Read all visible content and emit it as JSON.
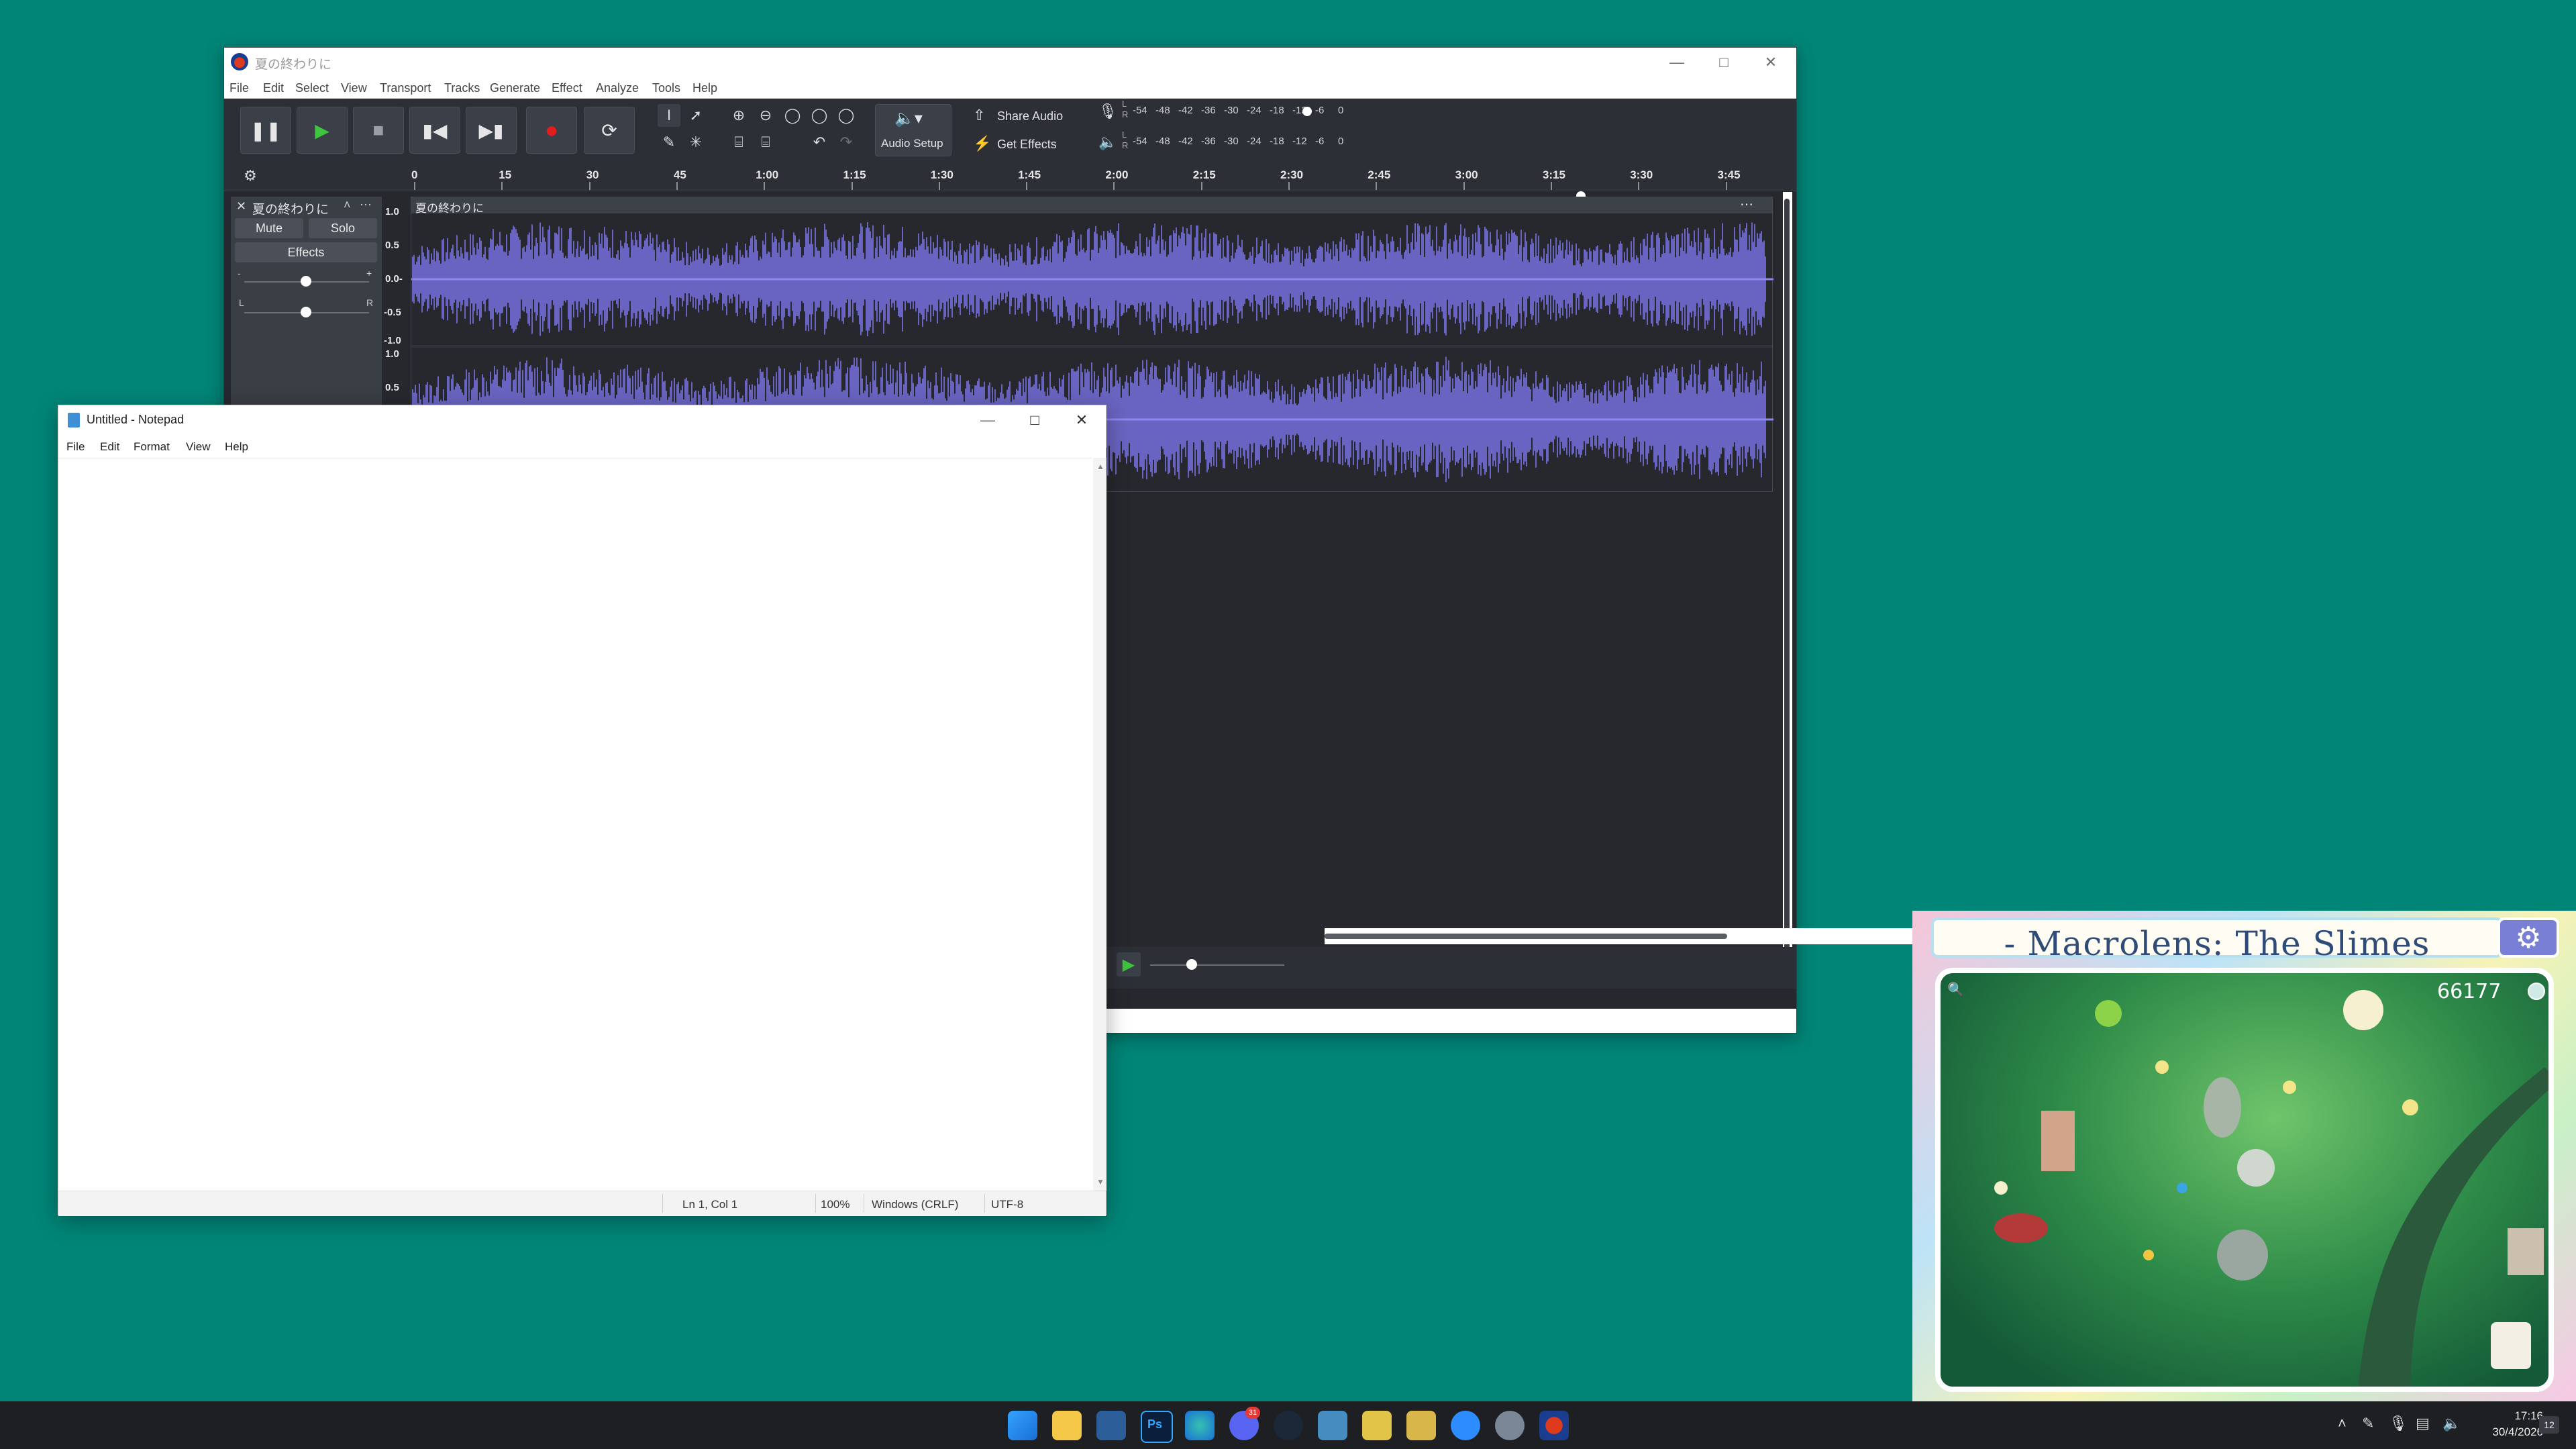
{
  "audacity": {
    "window_title": "夏の終わりに",
    "menu": [
      "File",
      "Edit",
      "Select",
      "View",
      "Transport",
      "Tracks",
      "Generate",
      "Effect",
      "Analyze",
      "Tools",
      "Help"
    ],
    "buttons": {
      "audio_setup": "Audio Setup",
      "share_audio": "Share Audio",
      "get_effects": "Get Effects"
    },
    "meter_record_labels": [
      "-54",
      "-48",
      "-42",
      "-36",
      "-30",
      "-24",
      "-18",
      "-12",
      "-6",
      "0"
    ],
    "meter_play_labels": [
      "-54",
      "-48",
      "-42",
      "-36",
      "-30",
      "-24",
      "-18",
      "-12",
      "-6",
      "0"
    ],
    "meter_channel": {
      "l": "L",
      "r": "R"
    },
    "ruler_ticks": [
      "0",
      "15",
      "30",
      "45",
      "1:00",
      "1:15",
      "1:30",
      "1:45",
      "2:00",
      "2:15",
      "2:30",
      "2:45",
      "3:00",
      "3:15",
      "3:30",
      "3:45"
    ],
    "track": {
      "name": "夏の終わりに",
      "clip_name": "夏の終わりに",
      "mute": "Mute",
      "solo": "Solo",
      "effects": "Effects",
      "gain_minus": "-",
      "gain_plus": "+",
      "pan_left": "L",
      "pan_right": "R",
      "y_labels_top": [
        "1.0",
        "0.5",
        "0.0-",
        "-0.5",
        "-1.0"
      ],
      "y_labels_bottom": [
        "1.0",
        "0.5"
      ]
    },
    "colors": {
      "waveform": "#7a74e6",
      "background": "#26282d"
    }
  },
  "notepad": {
    "title": "Untitled - Notepad",
    "menu": [
      "File",
      "Edit",
      "Format",
      "View",
      "Help"
    ],
    "status": {
      "position": "Ln 1, Col 1",
      "zoom": "100%",
      "line_ending": "Windows (CRLF)",
      "encoding": "UTF-8"
    }
  },
  "game": {
    "title": "-  Macrolens: The Slimes",
    "score": "66177"
  },
  "taskbar": {
    "time": "17:16",
    "date": "30/4/2026",
    "notification_count": "12",
    "icons": [
      "start-icon",
      "file-explorer-icon",
      "notepad-icon",
      "photoshop-icon",
      "edge-icon",
      "discord-icon",
      "steam-icon",
      "godot-icon",
      "app-icon",
      "app-icon-2",
      "zoom-icon",
      "settings-icon",
      "audacity-icon"
    ],
    "photoshop_label": "Ps",
    "discord_badge": "31"
  }
}
